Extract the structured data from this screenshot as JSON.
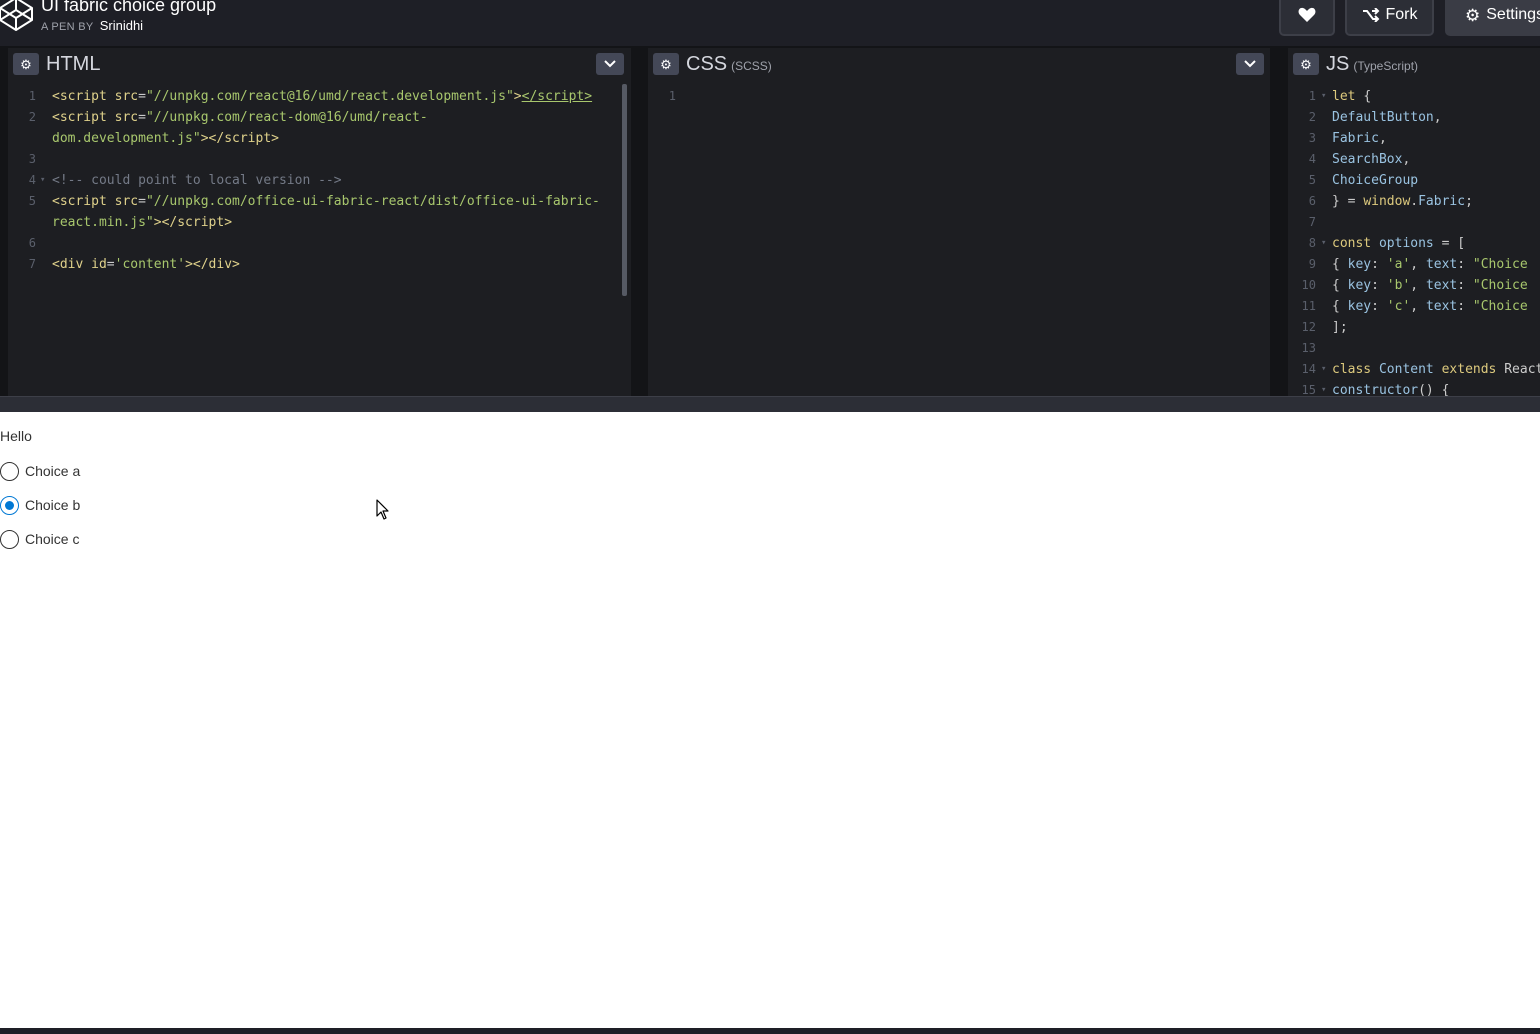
{
  "header": {
    "pen_title": "UI fabric choice group",
    "byline_prefix": "A PEN BY",
    "author": "Srinidhi",
    "fork_label": "Fork",
    "settings_label": "Settings"
  },
  "editors": {
    "html": {
      "title": "HTML",
      "lines": [
        {
          "n": "1",
          "fold": "",
          "html": "<span class='t'>&lt;script</span> <span class='a'>src</span><span class='p'>=</span><span class='s'>\"//unpkg.com/react@16/umd/react.development.js\"</span><span class='t'>&gt;</span><span class='u'>&lt;/script&gt;</span>"
        },
        {
          "n": "2",
          "fold": "",
          "html": "<span class='t'>&lt;script</span> <span class='a'>src</span><span class='p'>=</span><span class='s'>\"//unpkg.com/react-dom@16/umd/react-</span>"
        },
        {
          "n": "",
          "fold": "",
          "html": "<span class='s'>dom.development.js\"</span><span class='t'>&gt;&lt;/script&gt;</span>"
        },
        {
          "n": "3",
          "fold": "",
          "html": ""
        },
        {
          "n": "4",
          "fold": "▾",
          "html": "<span class='c'>&lt;!-- could point to local version --&gt;</span>"
        },
        {
          "n": "5",
          "fold": "",
          "html": "<span class='t'>&lt;script</span> <span class='a'>src</span><span class='p'>=</span><span class='s'>\"//unpkg.com/office-ui-fabric-react/dist/office-ui-fabric-</span>"
        },
        {
          "n": "",
          "fold": "",
          "html": "<span class='s'>react.min.js\"</span><span class='t'>&gt;&lt;/script&gt;</span>"
        },
        {
          "n": "6",
          "fold": "",
          "html": ""
        },
        {
          "n": "7",
          "fold": "",
          "html": "<span class='t'>&lt;div</span> <span class='a'>id</span><span class='p'>=</span><span class='s'>'content'</span><span class='t'>&gt;&lt;/div&gt;</span>"
        }
      ]
    },
    "css": {
      "title": "CSS",
      "subtitle": "(SCSS)",
      "lines": [
        {
          "n": "1",
          "fold": "",
          "html": ""
        }
      ]
    },
    "js": {
      "title": "JS",
      "subtitle": "(TypeScript)",
      "lines": [
        {
          "n": "1",
          "fold": "▾",
          "html": "<span class='k'>let</span> <span class='p'>{</span>"
        },
        {
          "n": "2",
          "fold": "",
          "html": "<span class='v'>  DefaultButton</span><span class='p'>,</span>"
        },
        {
          "n": "3",
          "fold": "",
          "html": "<span class='v'>  Fabric</span><span class='p'>,</span>"
        },
        {
          "n": "4",
          "fold": "",
          "html": "<span class='v'>  SearchBox</span><span class='p'>,</span>"
        },
        {
          "n": "5",
          "fold": "",
          "html": "<span class='v'>  ChoiceGroup</span>"
        },
        {
          "n": "6",
          "fold": "",
          "html": "<span class='p'>} = </span><span class='k'>window</span><span class='p'>.</span><span class='v'>Fabric</span><span class='p'>;</span>"
        },
        {
          "n": "7",
          "fold": "",
          "html": ""
        },
        {
          "n": "8",
          "fold": "▾",
          "html": "<span class='k'>const</span> <span class='v'>options</span> <span class='p'>= [</span>"
        },
        {
          "n": "9",
          "fold": "",
          "html": "<span class='p'>  { </span><span class='v'>key</span><span class='p'>: </span><span class='s'>'a'</span><span class='p'>, </span><span class='v'>text</span><span class='p'>: </span><span class='s'>\"Choice</span>"
        },
        {
          "n": "10",
          "fold": "",
          "html": "<span class='p'>  { </span><span class='v'>key</span><span class='p'>: </span><span class='s'>'b'</span><span class='p'>, </span><span class='v'>text</span><span class='p'>: </span><span class='s'>\"Choice</span>"
        },
        {
          "n": "11",
          "fold": "",
          "html": "<span class='p'>  { </span><span class='v'>key</span><span class='p'>: </span><span class='s'>'c'</span><span class='p'>, </span><span class='v'>text</span><span class='p'>: </span><span class='s'>\"Choice</span>"
        },
        {
          "n": "12",
          "fold": "",
          "html": "<span class='p'>];</span>"
        },
        {
          "n": "13",
          "fold": "",
          "html": ""
        },
        {
          "n": "14",
          "fold": "▾",
          "html": "<span class='k'>class</span> <span class='v'>Content</span> <span class='k'>extends</span> <span class='p'>React</span>"
        },
        {
          "n": "15",
          "fold": "▾",
          "html": "<span class='v'>  constructor</span><span class='p'>() {</span>"
        }
      ]
    }
  },
  "preview": {
    "group_label": "Hello",
    "choices": [
      {
        "label": "Choice a",
        "checked": false
      },
      {
        "label": "Choice b",
        "checked": true
      },
      {
        "label": "Choice c",
        "checked": false
      }
    ]
  },
  "colors": {
    "accent": "#0078d4",
    "editor_bg": "#1d1e22",
    "chrome_bg": "#131417"
  }
}
